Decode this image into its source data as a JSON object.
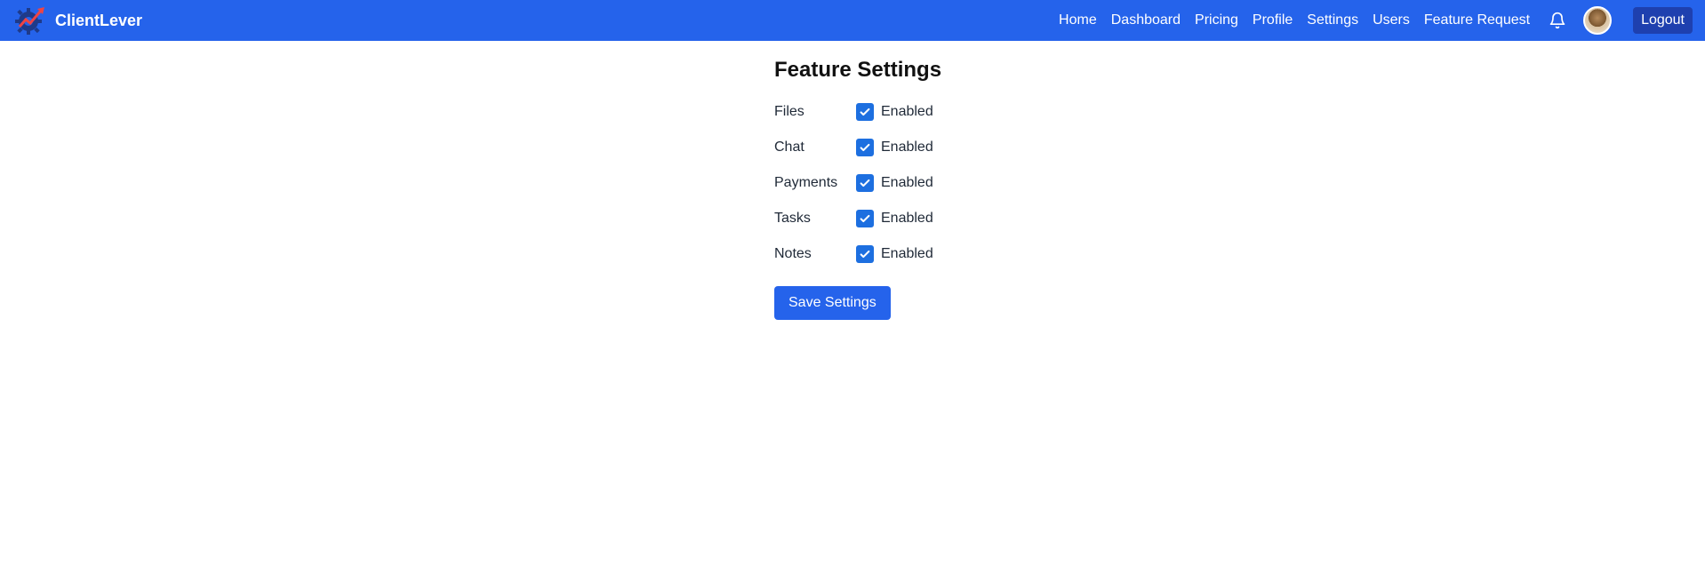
{
  "app": {
    "name": "ClientLever"
  },
  "nav": {
    "links": [
      "Home",
      "Dashboard",
      "Pricing",
      "Profile",
      "Settings",
      "Users",
      "Feature Request"
    ],
    "logout_label": "Logout",
    "icons": [
      "bell-icon",
      "avatar"
    ]
  },
  "colors": {
    "navbar": "#2563eb",
    "logout_bg": "#1e40af",
    "checkbox": "#1d6fe0",
    "button": "#2563eb"
  },
  "page": {
    "title": "Feature Settings",
    "features": [
      {
        "label": "Files",
        "checked": true,
        "status": "Enabled"
      },
      {
        "label": "Chat",
        "checked": true,
        "status": "Enabled"
      },
      {
        "label": "Payments",
        "checked": true,
        "status": "Enabled"
      },
      {
        "label": "Tasks",
        "checked": true,
        "status": "Enabled"
      },
      {
        "label": "Notes",
        "checked": true,
        "status": "Enabled"
      }
    ],
    "save_label": "Save Settings"
  }
}
